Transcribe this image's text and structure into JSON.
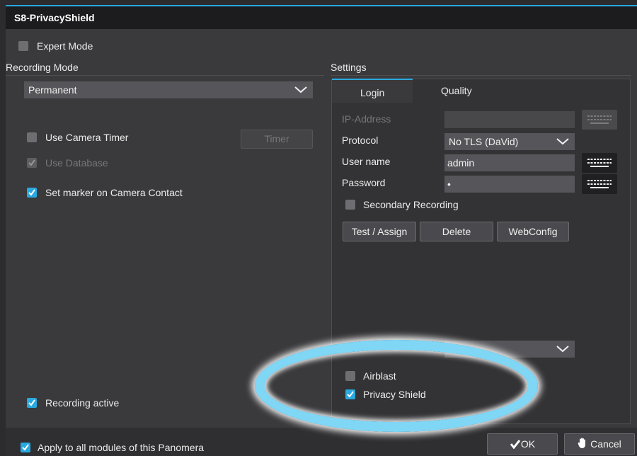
{
  "window": {
    "title": "S8-PrivacyShield"
  },
  "left": {
    "expert_mode": {
      "label": "Expert Mode",
      "checked": false
    },
    "recording_mode": {
      "label": "Recording Mode",
      "value": "Permanent"
    },
    "use_camera_timer": {
      "label": "Use Camera Timer",
      "checked": false
    },
    "timer_button": "Timer",
    "use_database": {
      "label": "Use Database",
      "checked": true,
      "disabled": true
    },
    "set_marker": {
      "label": "Set marker on Camera Contact",
      "checked": true
    },
    "recording_active": {
      "label": "Recording active",
      "checked": true
    }
  },
  "settings": {
    "title": "Settings",
    "tabs": [
      "Login",
      "Quality"
    ],
    "ip_address": {
      "label": "IP-Address",
      "value": ""
    },
    "protocol": {
      "label": "Protocol",
      "value": "No TLS (DaVid)"
    },
    "user_name": {
      "label": "User name",
      "value": "admin"
    },
    "password": {
      "label": "Password",
      "value": "•"
    },
    "secondary_recording": {
      "label": "Secondary Recording",
      "checked": false
    },
    "buttons": {
      "test_assign": "Test / Assign",
      "delete": "Delete",
      "webconfig": "WebConfig"
    },
    "lower_select": {
      "value": ""
    },
    "airblast": {
      "label": "Airblast",
      "checked": false
    },
    "privacy_shield": {
      "label": "Privacy Shield",
      "checked": true
    }
  },
  "footer": {
    "apply_all": {
      "label": "Apply to all modules of this Panomera",
      "checked": true
    },
    "ok": "OK",
    "cancel": "Cancel"
  },
  "colors": {
    "accent": "#2aa9e0",
    "highlight": "#7fd6f5"
  },
  "icons": [
    "checkmark-icon",
    "chevron-down-icon",
    "keyboard-icon",
    "hand-icon"
  ]
}
